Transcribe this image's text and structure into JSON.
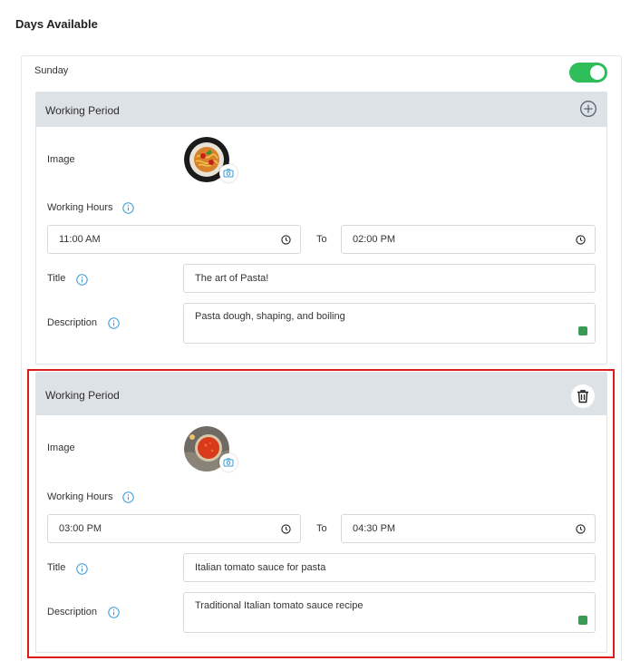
{
  "page": {
    "section_title": "Days Available"
  },
  "day": {
    "label": "Sunday",
    "enabled": true,
    "accent_color": "#2ebd59"
  },
  "periods": [
    {
      "header": "Working Period",
      "header_action": "add-icon",
      "image_label": "Image",
      "hours_label": "Working Hours",
      "start_time": "11:00  AM",
      "to_label": "To",
      "end_time": "02:00  PM",
      "title_label": "Title",
      "title_value": "The art of Pasta!",
      "description_label": "Description",
      "description_value": "Pasta dough, shaping, and boiling"
    },
    {
      "header": "Working Period",
      "header_action": "trash-icon",
      "image_label": "Image",
      "hours_label": "Working Hours",
      "start_time": "03:00  PM",
      "to_label": "To",
      "end_time": "04:30  PM",
      "title_label": "Title",
      "title_value": "Italian tomato sauce for pasta",
      "description_label": "Description",
      "description_value": "Traditional Italian tomato sauce recipe"
    }
  ],
  "highlight_color": "#e01b1b"
}
